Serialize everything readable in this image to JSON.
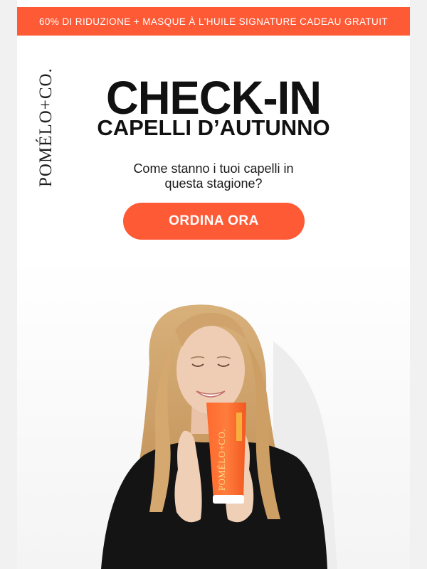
{
  "promo": {
    "text": "60% DI RIDUZIONE + MASQUE À L'HUILE SIGNATURE CADEAU GRATUIT"
  },
  "brand": {
    "logo_text": "POMÉLO+CO."
  },
  "headline": {
    "main": "CHECK-IN",
    "sub": "CAPELLI D’AUTUNNO"
  },
  "question": {
    "line1": "Come stanno i tuoi capelli in",
    "line2": "questa stagione?"
  },
  "cta": {
    "label": "ORDINA ORA"
  },
  "hero": {
    "product_label": "POMÉLO+CO."
  },
  "colors": {
    "accent": "#ff5a36",
    "text": "#111111",
    "background": "#ffffff",
    "page_background": "#f1f1f1"
  }
}
